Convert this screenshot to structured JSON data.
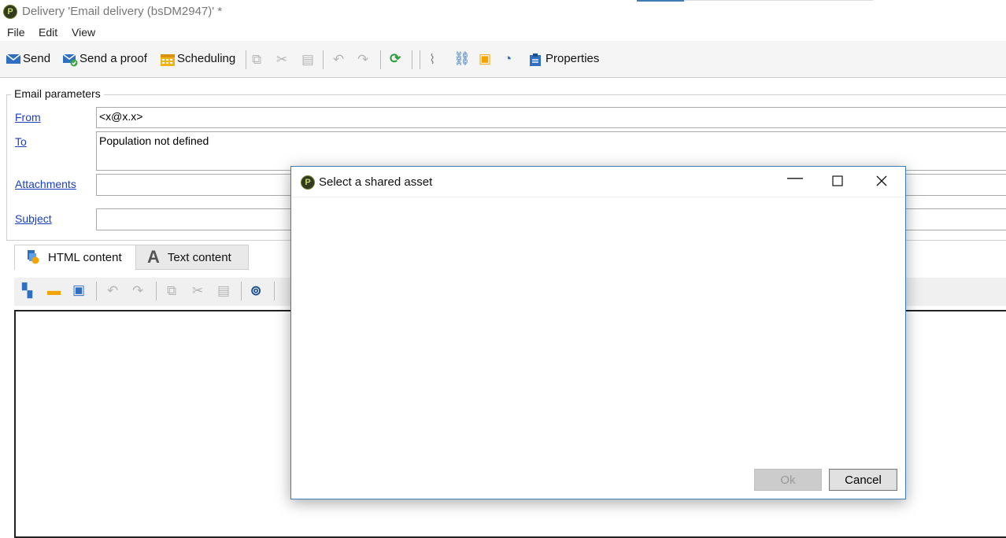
{
  "window": {
    "title": "Delivery 'Email delivery (bsDM2947)' *"
  },
  "menu": {
    "file": "File",
    "edit": "Edit",
    "view": "View"
  },
  "toolbar": {
    "send": "Send",
    "send_proof": "Send a proof",
    "scheduling": "Scheduling",
    "properties": "Properties"
  },
  "params": {
    "legend": "Email parameters",
    "from_label": "From",
    "from_value": "<x@x.x>",
    "to_label": "To",
    "to_value": "Population not defined",
    "attachments_label": "Attachments",
    "subject_label": "Subject"
  },
  "tabs": {
    "html": "HTML content",
    "text": "Text content"
  },
  "dialog": {
    "title": "Select a shared asset",
    "ok": "Ok",
    "cancel": "Cancel"
  },
  "colors": {
    "accent": "#3d7db3",
    "link": "#1a3fbf"
  }
}
